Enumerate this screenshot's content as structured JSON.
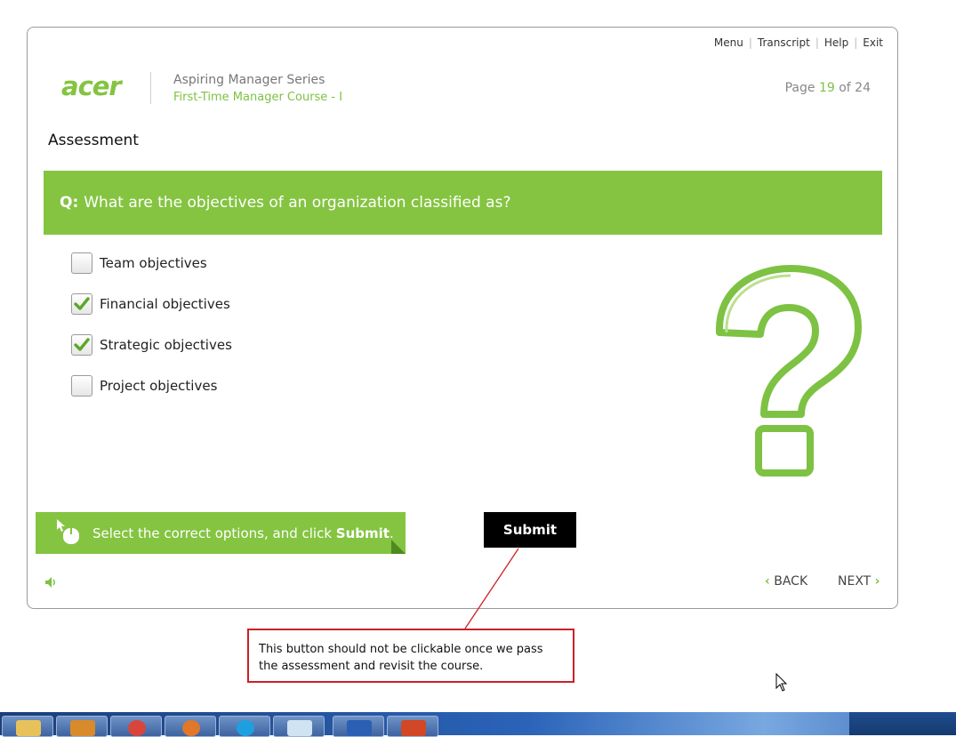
{
  "topnav": {
    "menu": "Menu",
    "transcript": "Transcript",
    "help": "Help",
    "exit": "Exit"
  },
  "header": {
    "logo_text": "acer",
    "series": "Aspiring Manager Series",
    "course": "First-Time Manager Course - I",
    "page_prefix": "Page",
    "page_current": "19",
    "page_of": "of 24"
  },
  "section_title": "Assessment",
  "question": {
    "prefix": "Q:",
    "text": "What are the objectives of an organization classified as?"
  },
  "options": [
    {
      "label": "Team objectives",
      "checked": false
    },
    {
      "label": "Financial objectives",
      "checked": true
    },
    {
      "label": "Strategic objectives",
      "checked": true
    },
    {
      "label": "Project objectives",
      "checked": false
    }
  ],
  "instruction": {
    "text_before": "Select the correct options, and click ",
    "bold": "Submit",
    "text_after": "."
  },
  "submit_label": "Submit",
  "nav": {
    "back": "BACK",
    "next": "NEXT"
  },
  "annotation_note": "This button should not be clickable once we pass the assessment and revisit the course.",
  "colors": {
    "accent": "#84c441",
    "accent_text": "#7dc243",
    "note_border": "#cc2027"
  },
  "icons": {
    "speaker": "speaker-icon",
    "mouse": "mouse-pointer-icon",
    "question": "question-mark-icon"
  }
}
